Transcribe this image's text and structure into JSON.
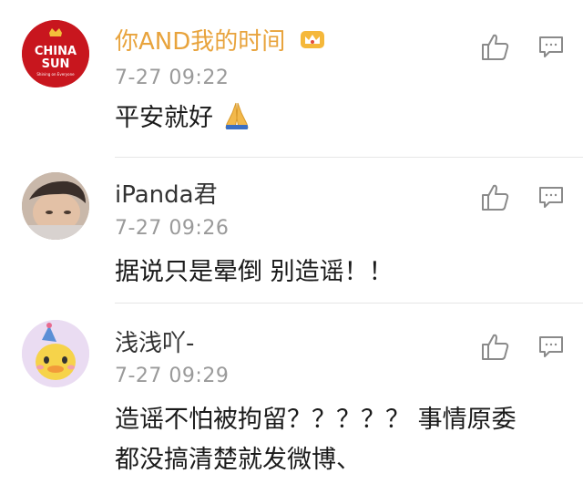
{
  "comments": [
    {
      "user": "你AND我的时间",
      "username_color": "#e8a33c",
      "avatar_text_line1": "CHINA",
      "avatar_text_line2": "SUN",
      "avatar_text_line3": "Shining on Everyone",
      "badge_icon": "crown-icon",
      "time": "7-27 09:22",
      "text": "平安就好",
      "emoji_icon": "praying-hands-icon"
    },
    {
      "user": "iPanda君",
      "username_color": "#333333",
      "time": "7-27 09:26",
      "text": "据说只是晕倒 别造谣！！"
    },
    {
      "user": "浅浅吖-",
      "username_color": "#333333",
      "time": "7-27 09:29",
      "text_line1": "造谣不怕被拘留？？？？？ 事情原委",
      "text_line2": "都没搞清楚就发微博、"
    }
  ],
  "icons": {
    "like": "thumbs-up-icon",
    "reply": "comment-icon"
  },
  "colors": {
    "icon_stroke": "#8a8a8a",
    "divider": "#e6e6e6",
    "time": "#9a9a9a"
  }
}
